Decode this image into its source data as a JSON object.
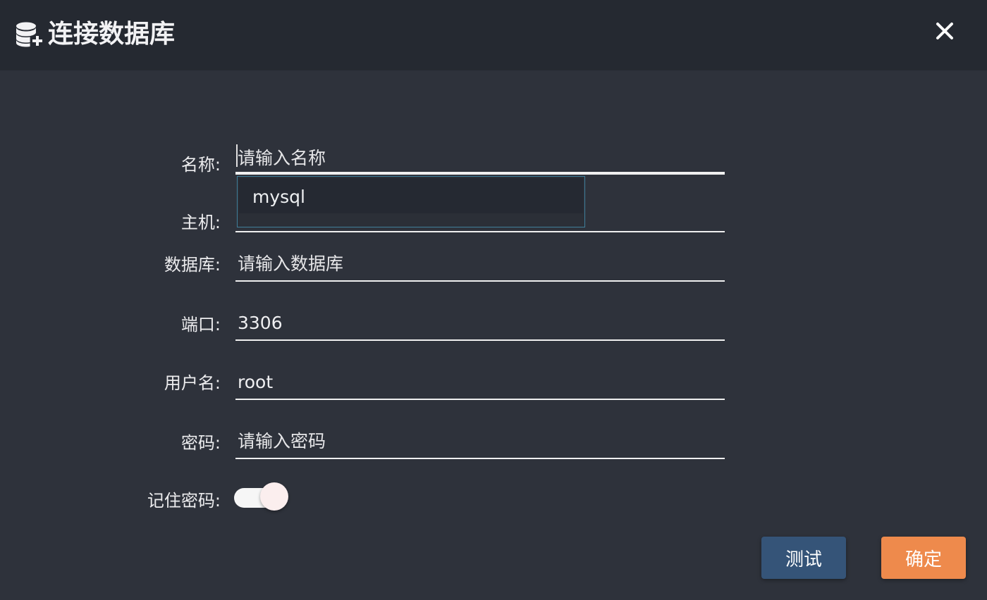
{
  "dialog": {
    "title": "连接数据库",
    "title_icon": "database-add-icon",
    "close_icon": "close-icon"
  },
  "form": {
    "name": {
      "label": "名称:",
      "placeholder": "请输入名称",
      "value": ""
    },
    "host": {
      "label": "主机:",
      "value": ""
    },
    "database": {
      "label": "数据库:",
      "placeholder": "请输入数据库",
      "value": ""
    },
    "port": {
      "label": "端口:",
      "value": "3306"
    },
    "username": {
      "label": "用户名:",
      "value": "root"
    },
    "password": {
      "label": "密码:",
      "placeholder": "请输入密码",
      "value": ""
    },
    "remember": {
      "label": "记住密码:",
      "checked": true
    }
  },
  "autocomplete": {
    "items": [
      "mysql"
    ]
  },
  "buttons": {
    "test_label": "测试",
    "ok_label": "确定"
  },
  "colors": {
    "background": "#2e323b",
    "header": "#252931",
    "test_button": "#355478",
    "ok_button": "#ee8a4c",
    "dropdown_border": "#3f7f9b"
  }
}
